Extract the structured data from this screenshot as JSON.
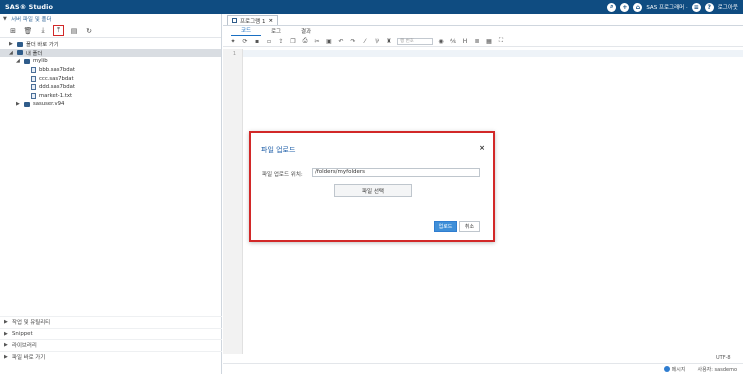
{
  "header": {
    "title": "SAS® Studio",
    "menu_label": "SAS 프로그래머 ·",
    "signout_label": "로그아웃"
  },
  "left_panel": {
    "section_title": "서버 파일 및 폴더",
    "tree": [
      {
        "label": "폴더 바로 가기",
        "indent": 1,
        "type": "folder",
        "expander": "▶"
      },
      {
        "label": "내 폴더",
        "indent": 1,
        "type": "folder",
        "expander": "◢",
        "selected": true
      },
      {
        "label": "mylib",
        "indent": 2,
        "type": "folder",
        "expander": "◢"
      },
      {
        "label": "bbb.sas7bdat",
        "indent": 3,
        "type": "file"
      },
      {
        "label": "ccc.sas7bdat",
        "indent": 3,
        "type": "file"
      },
      {
        "label": "ddd.sas7bdat",
        "indent": 3,
        "type": "file"
      },
      {
        "label": "market-1.txt",
        "indent": 3,
        "type": "file"
      },
      {
        "label": "sasuser.v94",
        "indent": 2,
        "type": "folder",
        "expander": "▶"
      }
    ],
    "accordion": [
      "작업 및 유틸리티",
      "Snippet",
      "라이브러리",
      "파일 바로 가기"
    ]
  },
  "editor": {
    "tab_label": "프로그램 1",
    "sub_tabs": [
      "코드",
      "로그",
      "결과"
    ],
    "active_sub_tab": 0,
    "line_search_placeholder": "행 번호",
    "line_number": "1"
  },
  "dialog": {
    "title": "파일 업로드",
    "location_label": "파일 업로드 위치:",
    "location_value": "/folders/myfolders",
    "choose_file_label": "파일 선택",
    "upload_label": "업로드",
    "cancel_label": "취소"
  },
  "status": {
    "encoding": "UTF-8",
    "messages_label": "메시지",
    "user_label": "사용자: sasdemo"
  },
  "colors": {
    "header": "#0f4c81",
    "accent": "#1a6fc2",
    "highlight_border": "#d22828",
    "primary_button": "#3f8fd8"
  }
}
